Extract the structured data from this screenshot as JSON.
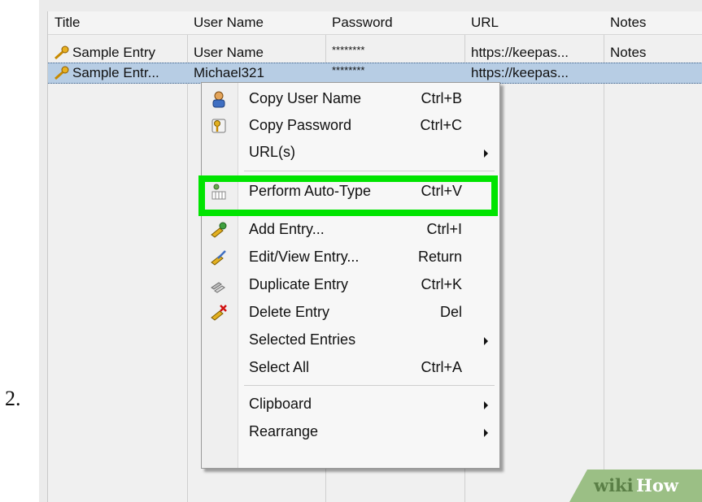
{
  "step_number": "2.",
  "table": {
    "headers": [
      "Title",
      "User Name",
      "Password",
      "URL",
      "Notes"
    ],
    "rows": [
      {
        "title": "Sample Entry",
        "user": "User Name",
        "password": "********",
        "url": "https://keepas...",
        "notes": "Notes"
      },
      {
        "title": "Sample Entr...",
        "user": "Michael321",
        "password": "********",
        "url": "https://keepas...",
        "notes": ""
      }
    ]
  },
  "context_menu": {
    "items": [
      {
        "label": "Copy User Name",
        "shortcut": "Ctrl+B",
        "icon": "user-icon"
      },
      {
        "label": "Copy Password",
        "shortcut": "Ctrl+C",
        "icon": "key-icon"
      },
      {
        "label": "URL(s)",
        "shortcut": "",
        "icon": "",
        "submenu": true
      },
      {
        "label": "Perform Auto-Type",
        "shortcut": "Ctrl+V",
        "icon": "auto-type-icon"
      },
      {
        "label": "Add Entry...",
        "shortcut": "Ctrl+I",
        "icon": "add-entry-icon"
      },
      {
        "label": "Edit/View Entry...",
        "shortcut": "Return",
        "icon": "edit-entry-icon"
      },
      {
        "label": "Duplicate Entry",
        "shortcut": "Ctrl+K",
        "icon": "duplicate-entry-icon"
      },
      {
        "label": "Delete Entry",
        "shortcut": "Del",
        "icon": "delete-entry-icon"
      },
      {
        "label": "Selected Entries",
        "shortcut": "",
        "icon": "",
        "submenu": true
      },
      {
        "label": "Select All",
        "shortcut": "Ctrl+A",
        "icon": ""
      },
      {
        "label": "Clipboard",
        "shortcut": "",
        "icon": "",
        "submenu": true
      },
      {
        "label": "Rearrange",
        "shortcut": "",
        "icon": "",
        "submenu": true
      }
    ]
  },
  "highlight_color": "#00e400",
  "selection_color": "#b7cde4",
  "watermark": {
    "part1": "wiki",
    "part2": "How"
  }
}
